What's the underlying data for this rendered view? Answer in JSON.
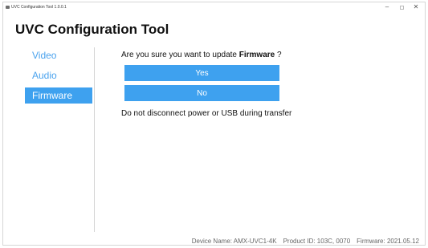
{
  "window": {
    "title": "UVC Configuration Tool 1.0.0.1",
    "minimize_glyph": "–",
    "close_glyph": "✕"
  },
  "app": {
    "title": "UVC Configuration Tool"
  },
  "sidebar": {
    "items": [
      {
        "label": "Video",
        "active": false
      },
      {
        "label": "Audio",
        "active": false
      },
      {
        "label": "Firmware",
        "active": true
      }
    ]
  },
  "dialog": {
    "prompt_prefix": "Are you sure you want to update ",
    "prompt_target": "Firmware",
    "prompt_suffix": " ?",
    "yes_label": "Yes",
    "no_label": "No",
    "warning": "Do not disconnect power or USB during transfer"
  },
  "status": {
    "device_name": "Device Name: AMX-UVC1-4K",
    "product_id": "Product ID: 103C, 0070",
    "firmware": "Firmware: 2021.05.12"
  },
  "colors": {
    "accent": "#3ea1ef",
    "nav_text": "#4ba3ee"
  }
}
